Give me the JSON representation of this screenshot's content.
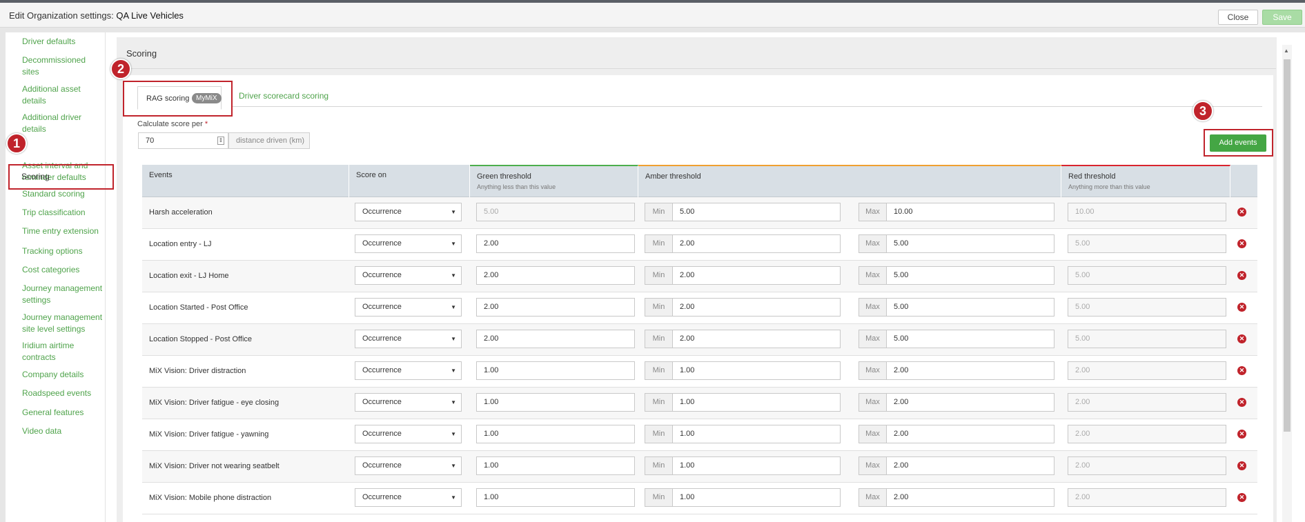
{
  "window": {
    "title_prefix": "Edit Organization settings:",
    "title_org": "QA Live Vehicles",
    "close_label": "Close",
    "save_label": "Save"
  },
  "sidebar": {
    "items": [
      {
        "label": "Driver defaults"
      },
      {
        "label": "Decommissioned sites"
      },
      {
        "label": "Additional asset details"
      },
      {
        "label": "Additional driver details"
      },
      {
        "label": "Scoring"
      },
      {
        "label": "Asset interval and reminder defaults"
      },
      {
        "label": "Standard scoring"
      },
      {
        "label": "Trip classification"
      },
      {
        "label": "Time entry extension"
      },
      {
        "label": "Tracking options"
      },
      {
        "label": "Cost categories"
      },
      {
        "label": "Journey management settings"
      },
      {
        "label": "Journey management site level settings"
      },
      {
        "label": "Iridium airtime contracts"
      },
      {
        "label": "Company details"
      },
      {
        "label": "Roadspeed events"
      },
      {
        "label": "General features"
      },
      {
        "label": "Video data"
      }
    ]
  },
  "section": {
    "title": "Scoring"
  },
  "tabs": {
    "active_label": "RAG scoring",
    "active_badge": "MyMiX",
    "second_label": "Driver scorecard scoring"
  },
  "calc": {
    "label": "Calculate score per",
    "required": "*",
    "value": "70",
    "unit": "distance driven (km)"
  },
  "add_events_label": "Add events",
  "callouts": [
    "1",
    "2",
    "3"
  ],
  "table": {
    "headers": {
      "events": "Events",
      "score_on": "Score on",
      "green": "Green threshold",
      "green_sub": "Anything less than this value",
      "amber": "Amber threshold",
      "red": "Red threshold",
      "red_sub": "Anything more than this value"
    },
    "min_label": "Min",
    "max_label": "Max",
    "threshold_colors": {
      "green": "#4cae4c",
      "amber": "#f0a030",
      "red": "#d9232d"
    },
    "rows": [
      {
        "event": "Harsh acceleration",
        "score_on": "Occurrence",
        "green": "5.00",
        "min": "5.00",
        "max": "10.00",
        "red": "10.00"
      },
      {
        "event": "Location entry - LJ",
        "score_on": "Occurrence",
        "green": "2.00",
        "min": "2.00",
        "max": "5.00",
        "red": "5.00"
      },
      {
        "event": "Location exit - LJ Home",
        "score_on": "Occurrence",
        "green": "2.00",
        "min": "2.00",
        "max": "5.00",
        "red": "5.00"
      },
      {
        "event": "Location Started - Post Office",
        "score_on": "Occurrence",
        "green": "2.00",
        "min": "2.00",
        "max": "5.00",
        "red": "5.00"
      },
      {
        "event": "Location Stopped - Post Office",
        "score_on": "Occurrence",
        "green": "2.00",
        "min": "2.00",
        "max": "5.00",
        "red": "5.00"
      },
      {
        "event": "MiX Vision: Driver distraction",
        "score_on": "Occurrence",
        "green": "1.00",
        "min": "1.00",
        "max": "2.00",
        "red": "2.00"
      },
      {
        "event": "MiX Vision: Driver fatigue - eye closing",
        "score_on": "Occurrence",
        "green": "1.00",
        "min": "1.00",
        "max": "2.00",
        "red": "2.00"
      },
      {
        "event": "MiX Vision: Driver fatigue - yawning",
        "score_on": "Occurrence",
        "green": "1.00",
        "min": "1.00",
        "max": "2.00",
        "red": "2.00"
      },
      {
        "event": "MiX Vision: Driver not wearing seatbelt",
        "score_on": "Occurrence",
        "green": "1.00",
        "min": "1.00",
        "max": "2.00",
        "red": "2.00"
      },
      {
        "event": "MiX Vision: Mobile phone distraction",
        "score_on": "Occurrence",
        "green": "1.00",
        "min": "1.00",
        "max": "2.00",
        "red": "2.00"
      }
    ]
  }
}
